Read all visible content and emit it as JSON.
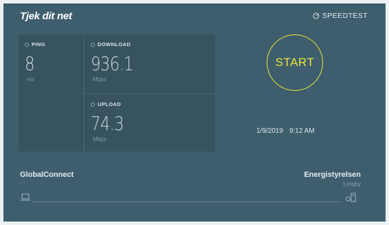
{
  "header": {
    "logo": "Tjek dit net",
    "brand": "SPEEDTEST",
    "brand_icon": "gauge-icon"
  },
  "metrics": {
    "ping": {
      "label": "PING",
      "value": "8",
      "unit": "ms"
    },
    "download": {
      "label": "DOWNLOAD",
      "value": "936.1",
      "unit": "Mbps"
    },
    "upload": {
      "label": "UPLOAD",
      "value": "74.3",
      "unit": "Mbps"
    }
  },
  "start_label": "START",
  "datetime": {
    "date": "1/9/2019",
    "time": "9:12 AM"
  },
  "connection": {
    "isp": "GlobalConnect",
    "isp_sub": "---",
    "server": "Energistyrelsen",
    "server_location": "Lyngby"
  },
  "colors": {
    "background": "#3e5e6e",
    "panel": "#36535f",
    "accent": "#ece53b"
  }
}
